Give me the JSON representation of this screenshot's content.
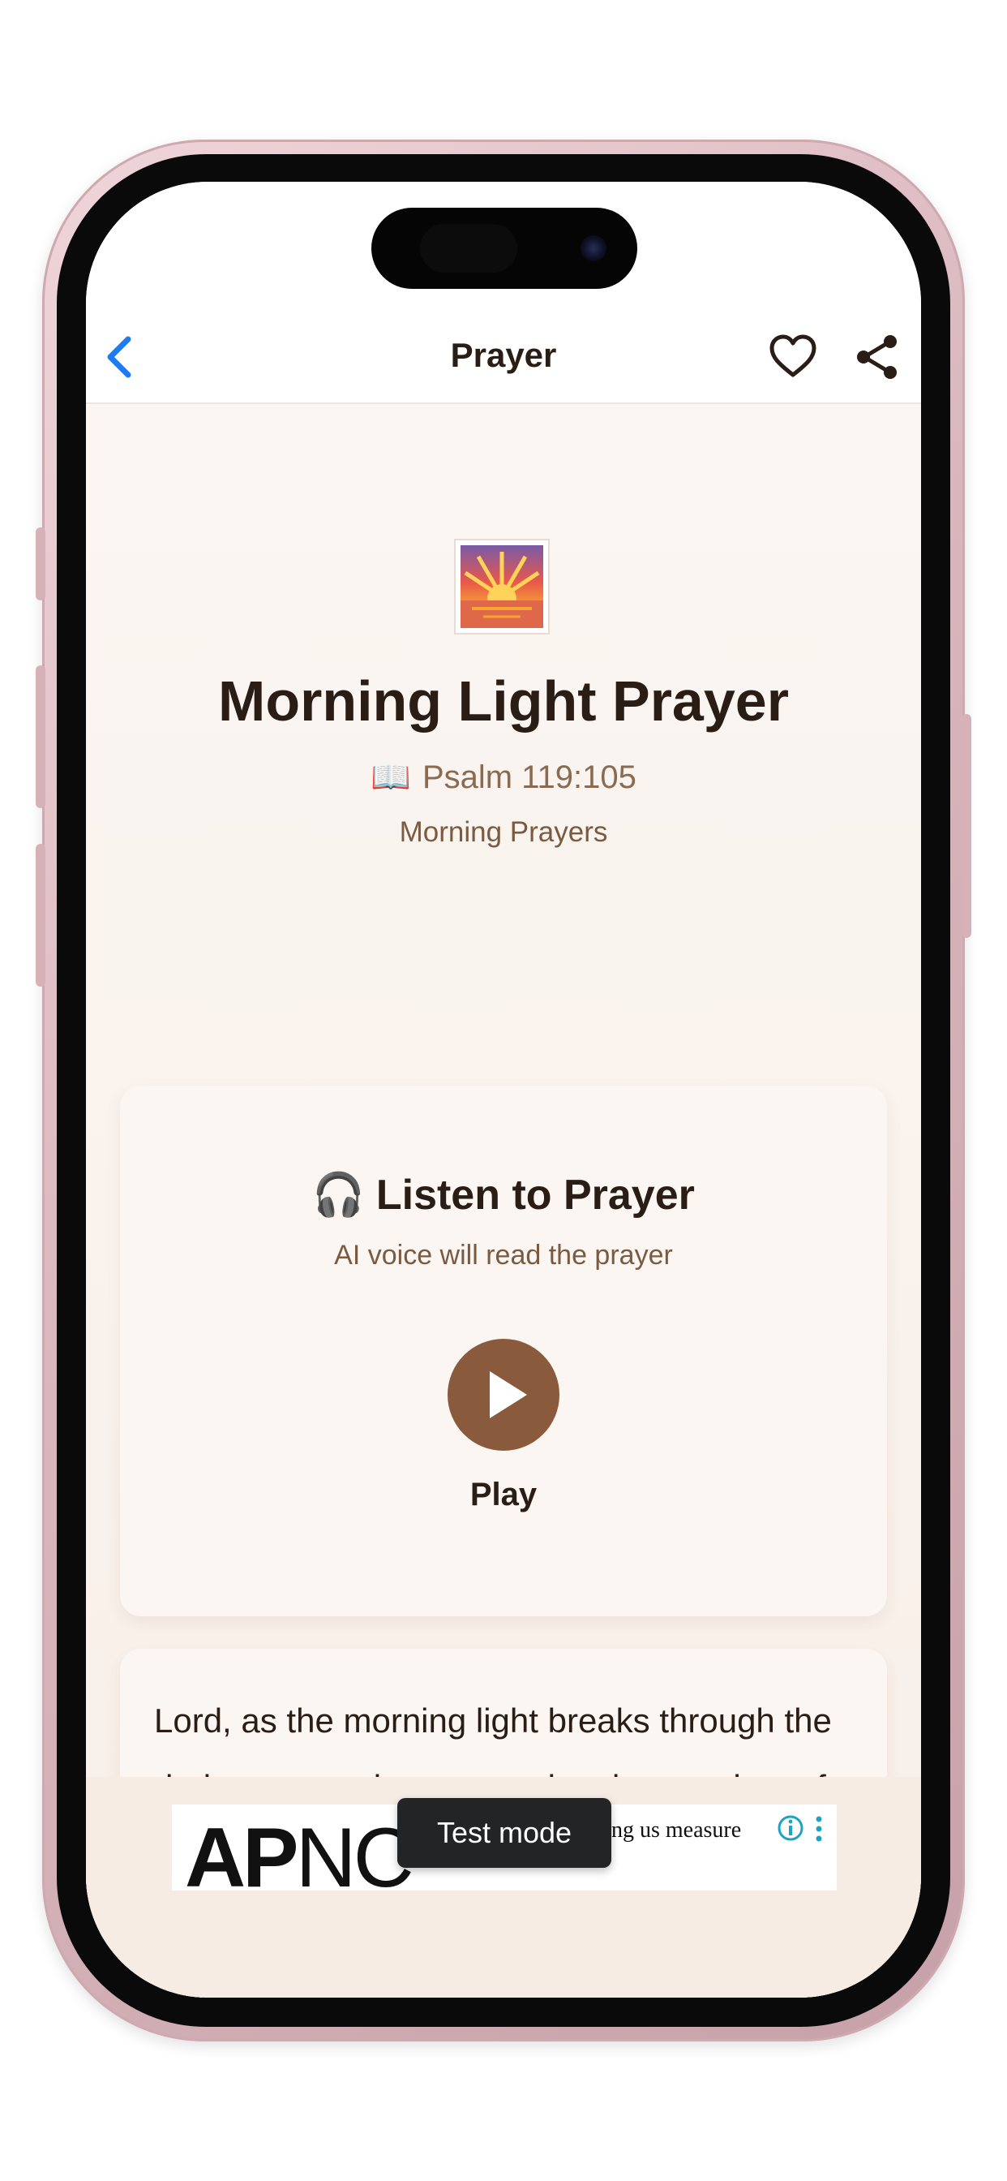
{
  "nav": {
    "title": "Prayer",
    "back_icon": "chevron-left-icon",
    "favorite_icon": "heart-icon",
    "share_icon": "share-icon",
    "accent_color": "#1e7cf2"
  },
  "prayer": {
    "icon": "sunrise-icon",
    "title": "Morning Light Prayer",
    "reference": "Psalm 119:105",
    "reference_icon": "📖",
    "category": "Morning Prayers",
    "text": "Lord, as the morning light breaks through the darkness, awaken my soul to the wonders of your love and grace. Guide my steps today, that I may walk in your ways and reflect your light to others. May your"
  },
  "listen": {
    "icon": "🎧",
    "title": "Listen to Prayer",
    "subtitle": "AI voice will read the prayer",
    "play_label": "Play",
    "play_color": "#8a5a3c"
  },
  "ad": {
    "logo_bold": "AP",
    "logo_rest": "NC",
    "text": "elping us measure",
    "test_mode_label": "Test mode",
    "info_icon": "info-icon",
    "more_icon": "more-vertical-icon"
  }
}
